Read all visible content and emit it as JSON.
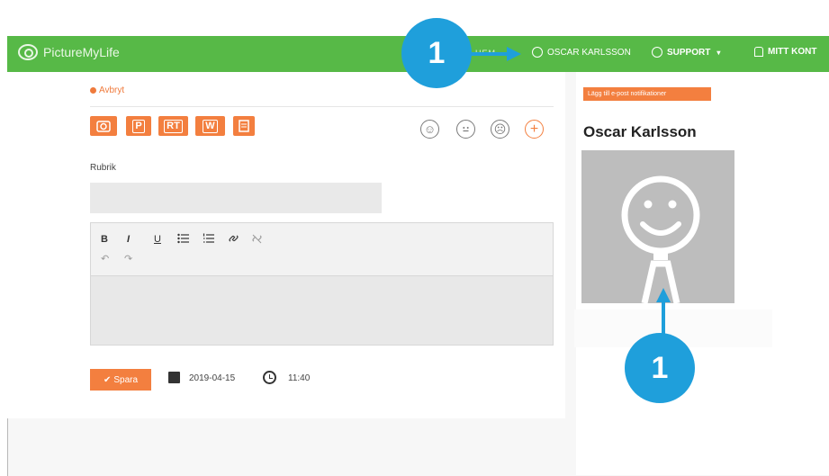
{
  "navbar": {
    "brand": "PictureMyLife",
    "faded_item": "HEM",
    "user_label": "OSCAR KARLSSON",
    "support_label": "SUPPORT",
    "account_label": "MITT KONT"
  },
  "form": {
    "cancel_label": "Avbryt",
    "type_buttons": [
      "P",
      "RT",
      "W"
    ],
    "title_label": "Rubrik",
    "title_value": "",
    "toolbar": {
      "bold": "B",
      "italic": "I",
      "underline": "U",
      "undo": "↶",
      "redo": "↷"
    },
    "save_label": "Spara",
    "date": "2019-04-15",
    "time": "11:40"
  },
  "mood_icons": [
    "happy-face-icon",
    "neutral-face-icon",
    "sad-face-icon",
    "add-icon"
  ],
  "sidebar": {
    "notification_button": "Lägg till e-post notifikationer",
    "user_name": "Oscar Karlsson"
  },
  "callouts": {
    "top": "1",
    "bottom": "1"
  },
  "colors": {
    "navbar": "#57b947",
    "accent_orange": "#f37f3f",
    "callout_blue": "#1f9fdb"
  }
}
